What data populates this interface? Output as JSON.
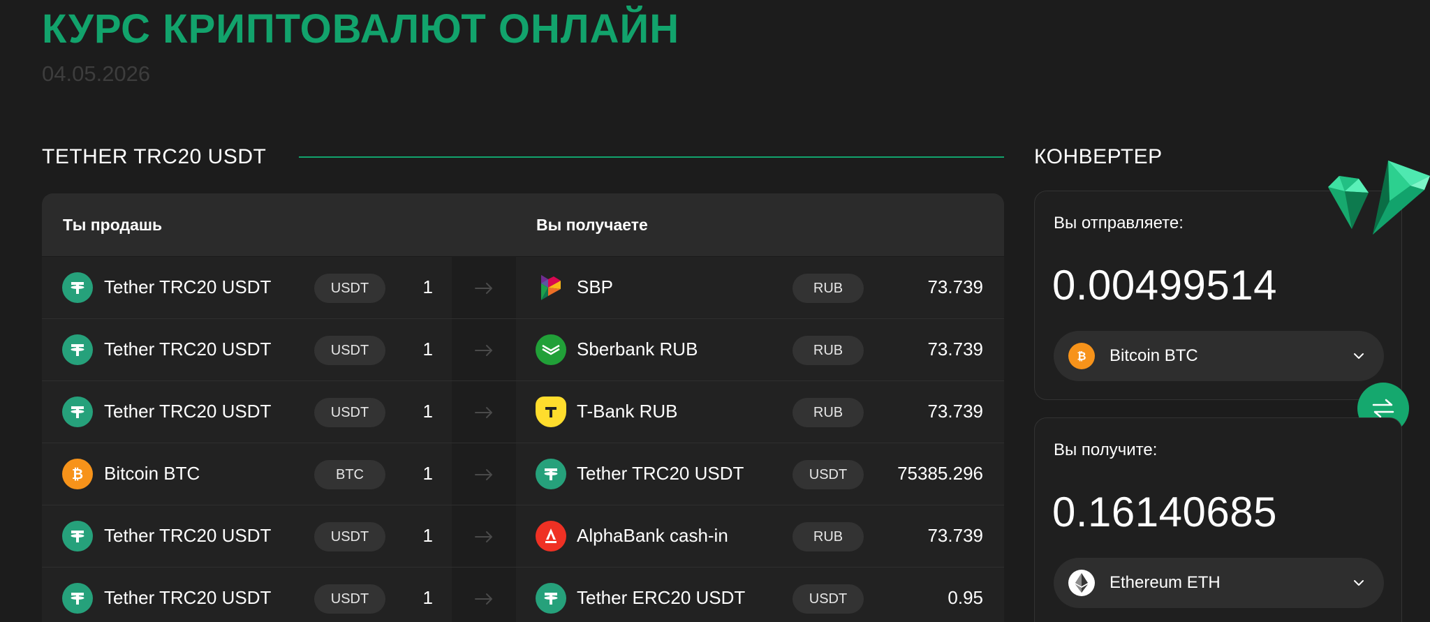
{
  "header": {
    "title": "КУРС КРИПТОВАЛЮТ ОНЛАЙН",
    "date": "04.05.2026"
  },
  "section": {
    "title": "TETHER TRC20 USDT"
  },
  "table": {
    "col_sell": "Ты продашь",
    "col_get": "Вы получаете",
    "rows": [
      {
        "from_name": "Tether TRC20 USDT",
        "from_code": "USDT",
        "from_amount": "1",
        "from_icon": "tether-icon",
        "to_name": "SBP",
        "to_code": "RUB",
        "to_amount": "73.739",
        "to_icon": "sbp-icon"
      },
      {
        "from_name": "Tether TRC20 USDT",
        "from_code": "USDT",
        "from_amount": "1",
        "from_icon": "tether-icon",
        "to_name": "Sberbank RUB",
        "to_code": "RUB",
        "to_amount": "73.739",
        "to_icon": "sberbank-icon"
      },
      {
        "from_name": "Tether TRC20 USDT",
        "from_code": "USDT",
        "from_amount": "1",
        "from_icon": "tether-icon",
        "to_name": "T-Bank RUB",
        "to_code": "RUB",
        "to_amount": "73.739",
        "to_icon": "tbank-icon"
      },
      {
        "from_name": "Bitcoin BTC",
        "from_code": "BTC",
        "from_amount": "1",
        "from_icon": "bitcoin-icon",
        "to_name": "Tether TRC20 USDT",
        "to_code": "USDT",
        "to_amount": "75385.296",
        "to_icon": "tether-icon"
      },
      {
        "from_name": "Tether TRC20 USDT",
        "from_code": "USDT",
        "from_amount": "1",
        "from_icon": "tether-icon",
        "to_name": "AlphaBank cash-in",
        "to_code": "RUB",
        "to_amount": "73.739",
        "to_icon": "alphabank-icon"
      },
      {
        "from_name": "Tether TRC20 USDT",
        "from_code": "USDT",
        "from_amount": "1",
        "from_icon": "tether-icon",
        "to_name": "Tether ERC20 USDT",
        "to_code": "USDT",
        "to_amount": "0.95",
        "to_icon": "tether-icon"
      }
    ]
  },
  "converter": {
    "title": "КОНВЕРТЕР",
    "send_label": "Вы отправляете:",
    "send_value": "0.00499514",
    "send_currency": "Bitcoin BTC",
    "receive_label": "Вы получите:",
    "receive_value": "0.16140685",
    "receive_currency": "Ethereum ETH"
  },
  "colors": {
    "accent": "#12a36c",
    "background": "#1c1c1c",
    "tether": "#26a17b",
    "bitcoin": "#f7931a",
    "alphabank": "#ef3124",
    "tbank": "#ffdd2d",
    "sberbank": "#21a038"
  }
}
